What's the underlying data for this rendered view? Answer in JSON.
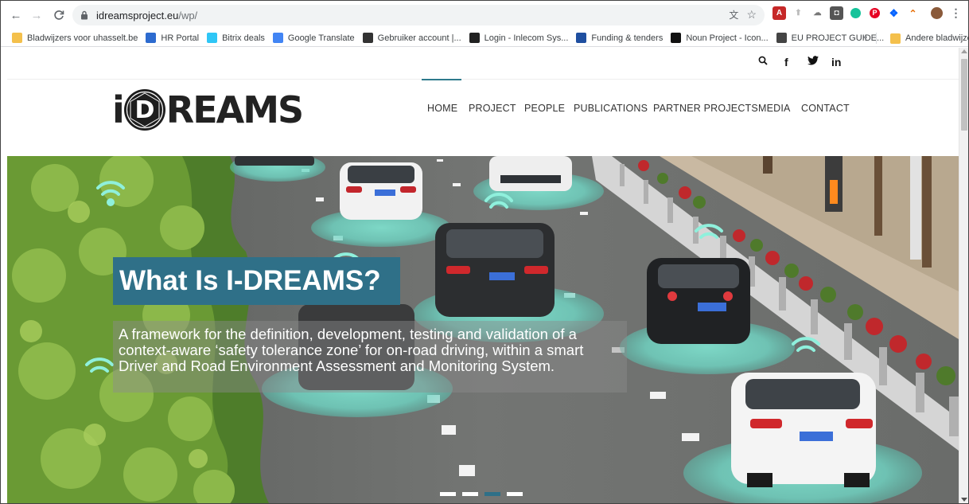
{
  "browser": {
    "url_domain": "idreamsproject.eu",
    "url_path": "/wp/",
    "bookmarks": [
      {
        "label": "Bladwijzers voor uhasselt.be",
        "icon": "folder-icon",
        "color": "#f4c04c"
      },
      {
        "label": "HR Portal",
        "icon": "hr-portal-icon",
        "color": "#2d6bcf"
      },
      {
        "label": "Bitrix deals",
        "icon": "bitrix24-icon",
        "color": "#2fc6f6"
      },
      {
        "label": "Google Translate",
        "icon": "google-translate-icon",
        "color": "#4285f4"
      },
      {
        "label": "Gebruiker account |...",
        "icon": "account-icon",
        "color": "#333333"
      },
      {
        "label": "Login - Inlecom Sys...",
        "icon": "inlecom-icon",
        "color": "#222222"
      },
      {
        "label": "Funding & tenders",
        "icon": "eu-flag-icon",
        "color": "#1f4fa0"
      },
      {
        "label": "Noun Project - Icon...",
        "icon": "noun-project-icon",
        "color": "#111111"
      },
      {
        "label": "EU PROJECT GUIDE...",
        "icon": "globe-icon",
        "color": "#444444"
      }
    ],
    "bookmarks_overflow": "»",
    "other_bookmarks": "Andere bladwijzers"
  },
  "site": {
    "logo_i": "i",
    "logo_d": "D",
    "logo_rest": "REAMS",
    "social": {
      "search": "⌕",
      "facebook": "f",
      "twitter": "🐦",
      "linkedin": "in"
    },
    "nav": [
      "HOME",
      "PROJECT",
      "PEOPLE",
      "PUBLICATIONS",
      "PARTNER PROJECTS",
      "MEDIA",
      "CONTACT"
    ],
    "nav_active": "HOME",
    "hero": {
      "title": "What Is I-DREAMS?",
      "subtitle_lines": [
        "A framework for the definition, development, testing and validation of a",
        "context-aware ‘safety tolerance zone’ for on-road driving, within a smart",
        "Driver and Road Environment Assessment and Monitoring System."
      ],
      "slides": 4,
      "active_slide": 3
    }
  },
  "colors": {
    "accent": "#2f7088",
    "wifi": "#7fe3d0"
  }
}
